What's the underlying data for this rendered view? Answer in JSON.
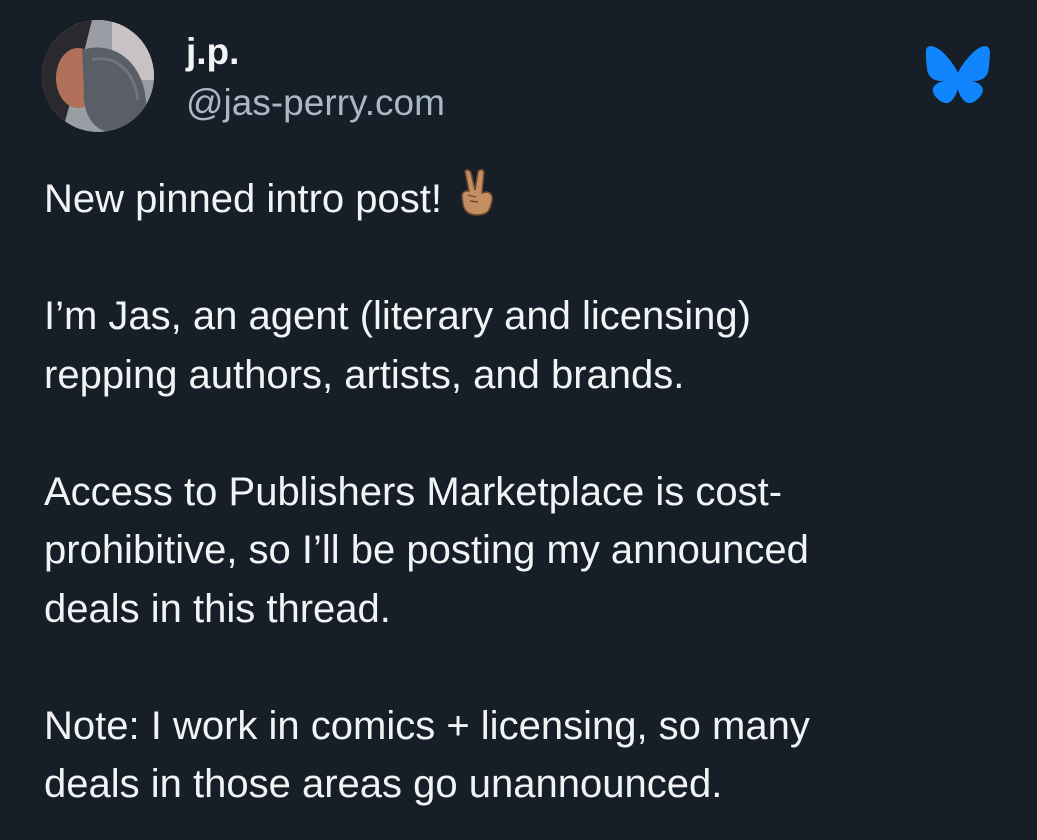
{
  "author": {
    "display_name": "j.p.",
    "handle": "@jas-perry.com"
  },
  "icons": {
    "platform_logo": "butterfly-icon",
    "emoji": "victory-hand-emoji"
  },
  "colors": {
    "background": "#161e27",
    "text": "#f1f3f5",
    "handle": "#aab8c6",
    "brand": "#1185fe"
  },
  "post": {
    "line1": "New pinned intro post!",
    "paragraph2": "I’m Jas, an agent (literary and licensing)\nrepping authors, artists, and brands.",
    "paragraph3": "Access to Publishers Marketplace is cost-\nprohibitive, so I’ll be posting my announced\ndeals in this thread.",
    "paragraph4": "Note: I work in comics + licensing, so many\ndeals in those areas go unannounced."
  }
}
